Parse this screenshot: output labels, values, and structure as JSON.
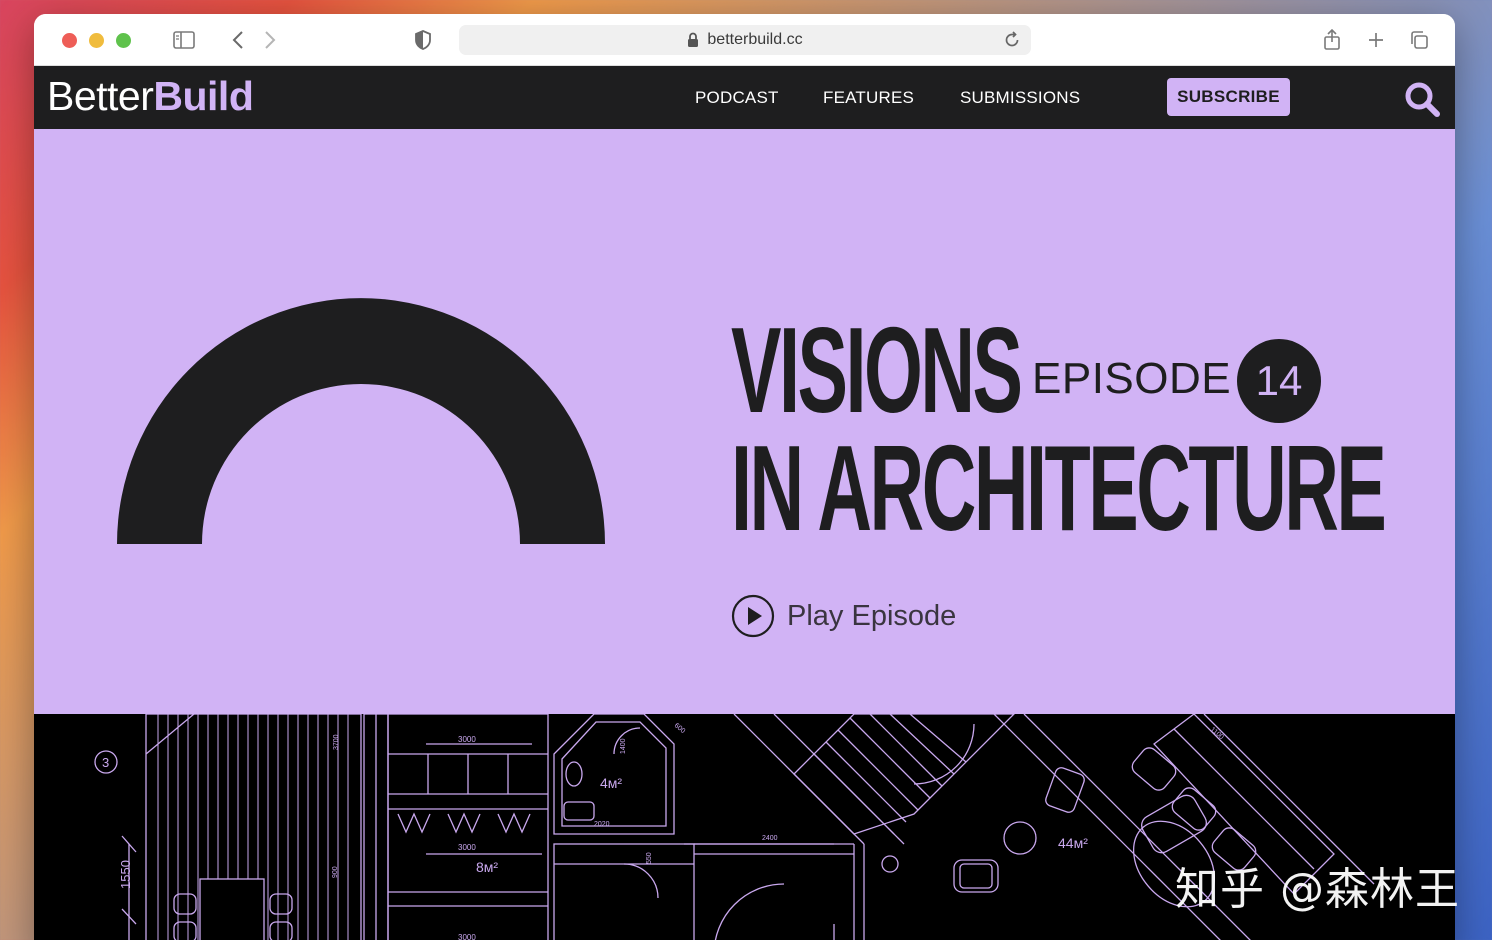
{
  "browser": {
    "url": "betterbuild.cc"
  },
  "site": {
    "logo_light": "Better",
    "logo_bold": "Build",
    "nav": [
      {
        "label": "PODCAST"
      },
      {
        "label": "FEATURES"
      },
      {
        "label": "SUBMISSIONS"
      }
    ],
    "subscribe_label": "SUBSCRIBE"
  },
  "hero": {
    "title_line1": "VISIONS",
    "episode_label": "EPISODE",
    "episode_number": "14",
    "title_line2": "IN ARCHITECTURE",
    "play_label": "Play Episode"
  },
  "blueprint": {
    "labels": [
      "3",
      "1550",
      "3000",
      "3000",
      "3000",
      "4м²",
      "8м²",
      "44м²",
      "2020",
      "1400",
      "2400",
      "3700",
      "1100",
      "600",
      "900",
      "550"
    ]
  },
  "watermark": "知乎 @森林王",
  "colors": {
    "accent": "#d1b3f5",
    "dark": "#1e1e1f",
    "blueprint_line": "#c9a8ee"
  }
}
